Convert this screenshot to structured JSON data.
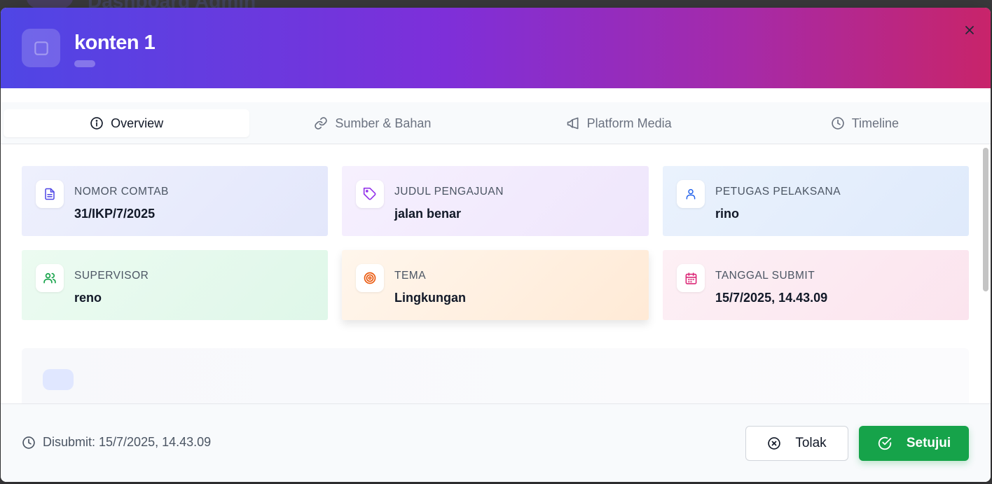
{
  "backdrop": {
    "title": "Dashboard Admin"
  },
  "modal": {
    "title": "konten 1",
    "close_icon": "close-icon"
  },
  "tabs": [
    {
      "label": "Overview",
      "icon": "info-icon",
      "active": true
    },
    {
      "label": "Sumber & Bahan",
      "icon": "link-icon",
      "active": false
    },
    {
      "label": "Platform Media",
      "icon": "megaphone-icon",
      "active": false
    },
    {
      "label": "Timeline",
      "icon": "clock-icon",
      "active": false
    }
  ],
  "cards": [
    {
      "label": "NOMOR COMTAB",
      "value": "31/IKP/7/2025",
      "icon": "document-icon",
      "color": "#4f46e5"
    },
    {
      "label": "JUDUL PENGAJUAN",
      "value": "jalan benar",
      "icon": "tag-icon",
      "color": "#9333ea"
    },
    {
      "label": "PETUGAS PELAKSANA",
      "value": "rino",
      "icon": "user-icon",
      "color": "#2563eb"
    },
    {
      "label": "SUPERVISOR",
      "value": "reno",
      "icon": "users-icon",
      "color": "#16a34a"
    },
    {
      "label": "TEMA",
      "value": "Lingkungan",
      "icon": "target-icon",
      "color": "#ea580c"
    },
    {
      "label": "TANGGAL SUBMIT",
      "value": "15/7/2025, 14.43.09",
      "icon": "calendar-icon",
      "color": "#db2777"
    }
  ],
  "footer": {
    "submitted_text": "Disubmit: 15/7/2025, 14.43.09",
    "reject_label": "Tolak",
    "approve_label": "Setujui"
  },
  "colors": {
    "header_gradient_start": "#4f46e5",
    "header_gradient_mid": "#7e2fd9",
    "header_gradient_end": "#c8246a",
    "approve": "#16a34a"
  }
}
